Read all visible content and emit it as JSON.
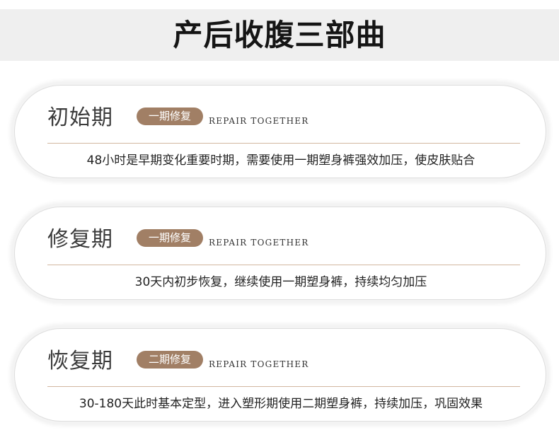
{
  "page": {
    "title": "产后收腹三部曲"
  },
  "stages": [
    {
      "title": "初始期",
      "badge": "一期修复",
      "tagline": "REPAIR TOGETHER",
      "description": "48小时是早期变化重要时期，需要使用一期塑身裤强效加压，使皮肤贴合"
    },
    {
      "title": "修复期",
      "badge": "一期修复",
      "tagline": "REPAIR TOGETHER",
      "description": "30天内初步恢复，继续使用一期塑身裤，持续均匀加压"
    },
    {
      "title": "恢复期",
      "badge": "二期修复",
      "tagline": "REPAIR TOGETHER",
      "description": "30-180天此时基本定型，进入塑形期使用二期塑身裤，持续加压，巩固效果"
    }
  ],
  "colors": {
    "badge": "#a17f65",
    "divider": "#d2b7a0",
    "header_bg": "#efefef"
  }
}
